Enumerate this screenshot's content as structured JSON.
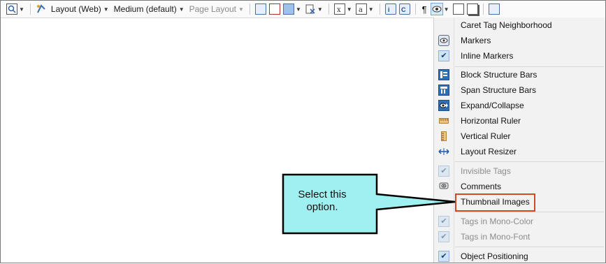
{
  "toolbar": {
    "layout_view": "Layout (Web)",
    "medium": "Medium (default)",
    "page_layout": "Page Layout"
  },
  "menu": {
    "items": [
      {
        "label": "Caret Tag Neighborhood",
        "icon": "none",
        "state": "normal"
      },
      {
        "label": "Markers",
        "icon": "markers-icon",
        "state": "normal"
      },
      {
        "label": "Inline Markers",
        "icon": "checkmark",
        "state": "checked"
      },
      {
        "label": "Block Structure Bars",
        "icon": "block-structure-bars-icon",
        "state": "normal"
      },
      {
        "label": "Span Structure Bars",
        "icon": "span-structure-bars-icon",
        "state": "normal"
      },
      {
        "label": "Expand/Collapse",
        "icon": "expand-collapse-icon",
        "state": "normal"
      },
      {
        "label": "Horizontal Ruler",
        "icon": "horizontal-ruler-icon",
        "state": "normal"
      },
      {
        "label": "Vertical Ruler",
        "icon": "vertical-ruler-icon",
        "state": "normal"
      },
      {
        "label": "Layout Resizer",
        "icon": "layout-resizer-icon",
        "state": "normal"
      },
      {
        "label": "Invisible Tags",
        "icon": "checkmark",
        "state": "checked-disabled"
      },
      {
        "label": "Comments",
        "icon": "comments-icon",
        "state": "normal"
      },
      {
        "label": "Thumbnail Images",
        "icon": "none",
        "state": "highlighted"
      },
      {
        "label": "Tags in Mono-Color",
        "icon": "checkmark",
        "state": "checked-disabled"
      },
      {
        "label": "Tags in Mono-Font",
        "icon": "checkmark",
        "state": "checked-disabled"
      },
      {
        "label": "Object Positioning",
        "icon": "checkmark",
        "state": "checked"
      }
    ]
  },
  "callout": {
    "text": "Select this option.",
    "fill": "#9ff0f0",
    "border": "#000000"
  },
  "colors": {
    "highlight_border": "#d04a2a",
    "check_fill": "#cfe2f7"
  }
}
